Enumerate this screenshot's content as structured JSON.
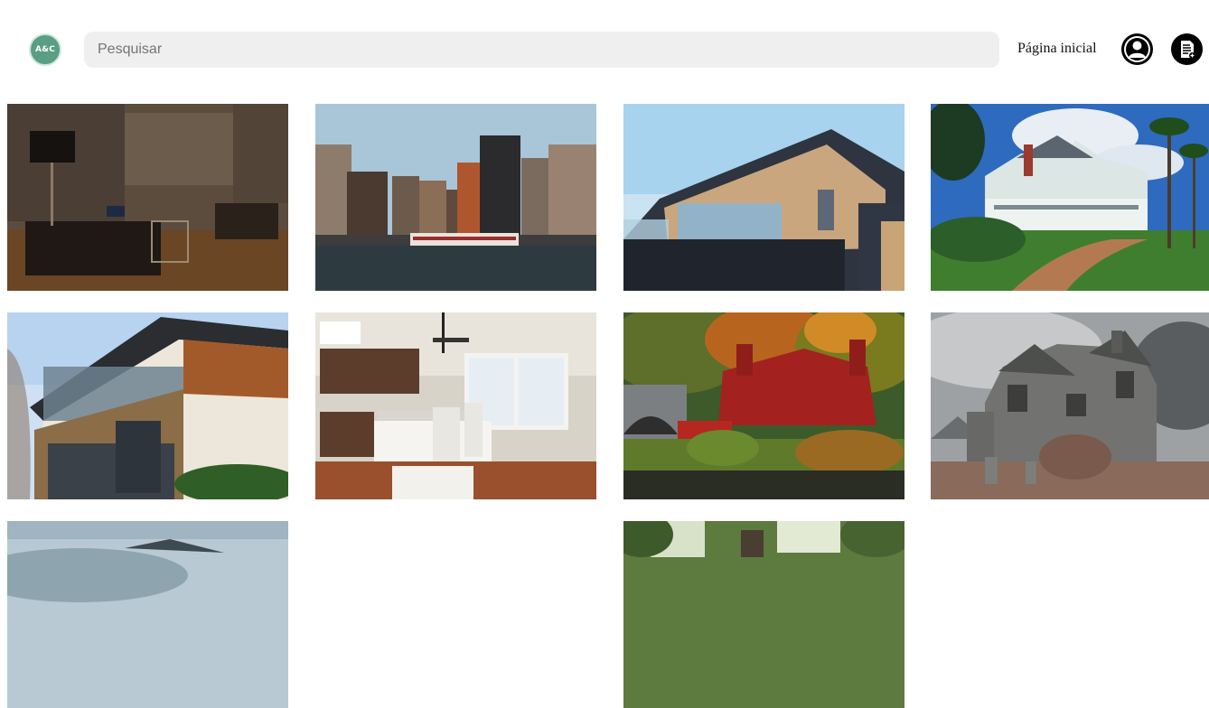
{
  "header": {
    "logo_text": "A&C",
    "search_placeholder": "Pesquisar",
    "nav_home_label": "Página inicial",
    "user_icon": "user-circle-icon",
    "doc_icon": "document-add-icon"
  },
  "gallery": {
    "items": [
      {
        "name": "stone-living-room"
      },
      {
        "name": "amsterdam-canal-houses"
      },
      {
        "name": "modern-flat-roof-house"
      },
      {
        "name": "victorian-mansion"
      },
      {
        "name": "modern-wood-stone-house"
      },
      {
        "name": "white-kitchen-island"
      },
      {
        "name": "ivy-covered-cottage"
      },
      {
        "name": "haunted-stone-house"
      },
      {
        "name": "mountain-landscape"
      },
      {
        "name": "forest-house"
      }
    ]
  },
  "colors": {
    "logo_bg": "#5a9e84",
    "search_bg": "#efefef"
  }
}
